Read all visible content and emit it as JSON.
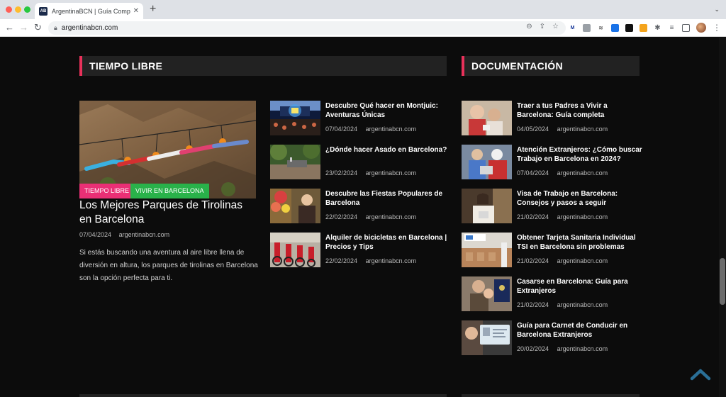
{
  "browser": {
    "tab_title": "ArgentinaBCN | Guía Completa",
    "tab_favicon": "AB",
    "url": "argentinabcn.com"
  },
  "colors": {
    "accent": "#e8315a",
    "tag_pink": "#ea2f75",
    "tag_green": "#29b24a",
    "background": "#0c0c0c",
    "heading_bg": "#222222",
    "backtop": "#2a6f97"
  },
  "tiempo_libre": {
    "heading": "TIEMPO LIBRE",
    "featured": {
      "tags": [
        "TIEMPO LIBRE",
        "VIVIR EN BARCELONA"
      ],
      "title": "Los Mejores Parques de Tirolinas en Barcelona",
      "date": "07/04/2024",
      "author": "argentinabcn.com",
      "excerpt": "Si estás buscando una aventura al aire libre llena de diversión en altura, los parques de tirolinas en Barcelona son la opción perfecta para ti."
    },
    "items": [
      {
        "title": "Descubre Qué hacer en Montjuic: Aventuras Únicas",
        "date": "07/04/2024",
        "author": "argentinabcn.com"
      },
      {
        "title": "¿Dónde hacer Asado en Barcelona?",
        "date": "23/02/2024",
        "author": "argentinabcn.com"
      },
      {
        "title": "Descubre las Fiestas Populares de Barcelona",
        "date": "22/02/2024",
        "author": "argentinabcn.com"
      },
      {
        "title": "Alquiler de bicicletas en Barcelona | Precios y Tips",
        "date": "22/02/2024",
        "author": "argentinabcn.com"
      }
    ]
  },
  "documentacion": {
    "heading": "DOCUMENTACIÓN",
    "items": [
      {
        "title": "Traer a tus Padres a Vivir a Barcelona: Guía completa",
        "date": "04/05/2024",
        "author": "argentinabcn.com"
      },
      {
        "title": "Atención Extranjeros: ¿Cómo buscar Trabajo en Barcelona en 2024?",
        "date": "07/04/2024",
        "author": "argentinabcn.com"
      },
      {
        "title": "Visa de Trabajo en Barcelona: Consejos y pasos a seguir",
        "date": "21/02/2024",
        "author": "argentinabcn.com"
      },
      {
        "title": "Obtener Tarjeta Sanitaria Individual TSI en Barcelona sin problemas",
        "date": "21/02/2024",
        "author": "argentinabcn.com"
      },
      {
        "title": "Casarse en Barcelona: Guía para Extranjeros",
        "date": "21/02/2024",
        "author": "argentinabcn.com"
      },
      {
        "title": "Guía para Carnet de Conducir en Barcelona Extranjeros",
        "date": "20/02/2024",
        "author": "argentinabcn.com"
      }
    ]
  }
}
